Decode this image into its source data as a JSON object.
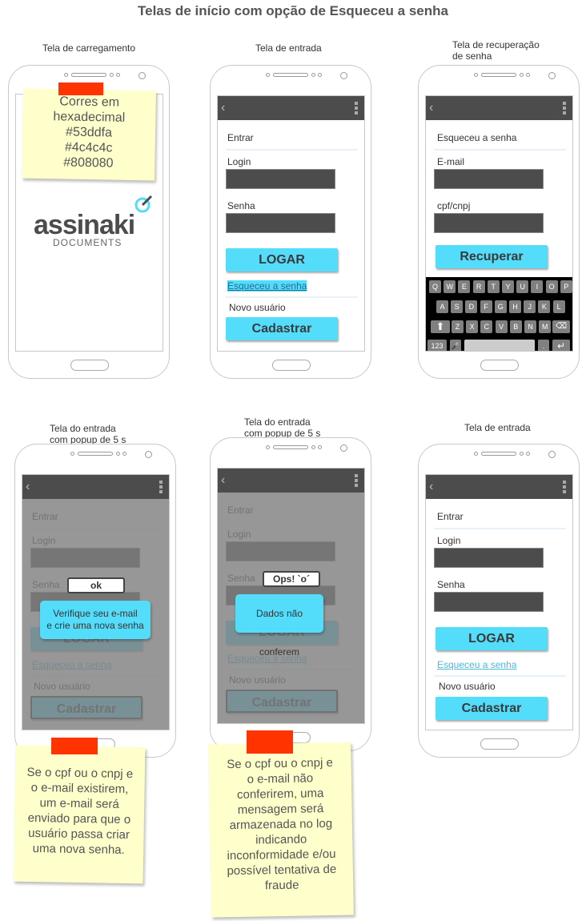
{
  "title": "Telas de início com opção de Esqueceu a senha",
  "captions": {
    "s1": "Tela de carregamento",
    "s2": "Tela de entrada",
    "s3_line1": "Tela de recuperação",
    "s3_line2": "de senha",
    "s4_line1": "Tela do entrada",
    "s4_line2": "com popup de 5 s",
    "s5_line1": "Tela do entrada",
    "s5_line2": "com popup de 5 s",
    "s6": "Tela de entrada"
  },
  "colors": {
    "accent": "#53ddfa",
    "dark": "#4c4c4c",
    "gray": "#808080",
    "note": "#ffffcc",
    "tape": "#ff3300"
  },
  "note_colors": {
    "line1": "Corres em",
    "line2": "hexadecimal",
    "line3": "#53ddfa",
    "line4": "#4c4c4c",
    "line5": "#808080"
  },
  "logo": {
    "main_a": "assina",
    "main_b": "ki",
    "sub": "DOCUMENTS"
  },
  "login": {
    "header": "Entrar",
    "login_label": "Login",
    "password_label": "Senha",
    "login_button": "LOGAR",
    "forgot_link": "Esqueceu a senha",
    "new_user": "Novo usuário",
    "register_button": "Cadastrar"
  },
  "recovery": {
    "header": "Esqueceu a senha",
    "email_label": "E-mail",
    "doc_label": "cpf/cnpj",
    "recover_button": "Recuperar"
  },
  "keyboard": {
    "row1": [
      "Q",
      "W",
      "E",
      "R",
      "T",
      "Y",
      "U",
      "I",
      "O",
      "P"
    ],
    "row2": [
      "A",
      "S",
      "D",
      "F",
      "G",
      "H",
      "J",
      "K",
      "L"
    ],
    "row3": [
      "Z",
      "X",
      "C",
      "V",
      "B",
      "N",
      "M"
    ],
    "num_key": "123",
    "dot_key": "."
  },
  "popup_success": {
    "ok": "ok",
    "message_line1": "Verifique seu e-mail",
    "message_line2": "e crie uma nova senha"
  },
  "popup_error": {
    "ok": "Ops! `o´",
    "message": "Dados não conferem"
  },
  "note_success": [
    "Se o cpf ou o cnpj e",
    "o e-mail existirem,",
    "um e-mail será",
    "enviado para que o",
    "usuário passa criar",
    "uma nova senha."
  ],
  "note_error": [
    "Se o cpf ou o cnpj e",
    "o e-mail não",
    "conferirem, uma",
    "mensagem será",
    "armazenada no log",
    "indicando",
    "inconformidade e/ou",
    "possível tentativa de",
    "fraude"
  ]
}
